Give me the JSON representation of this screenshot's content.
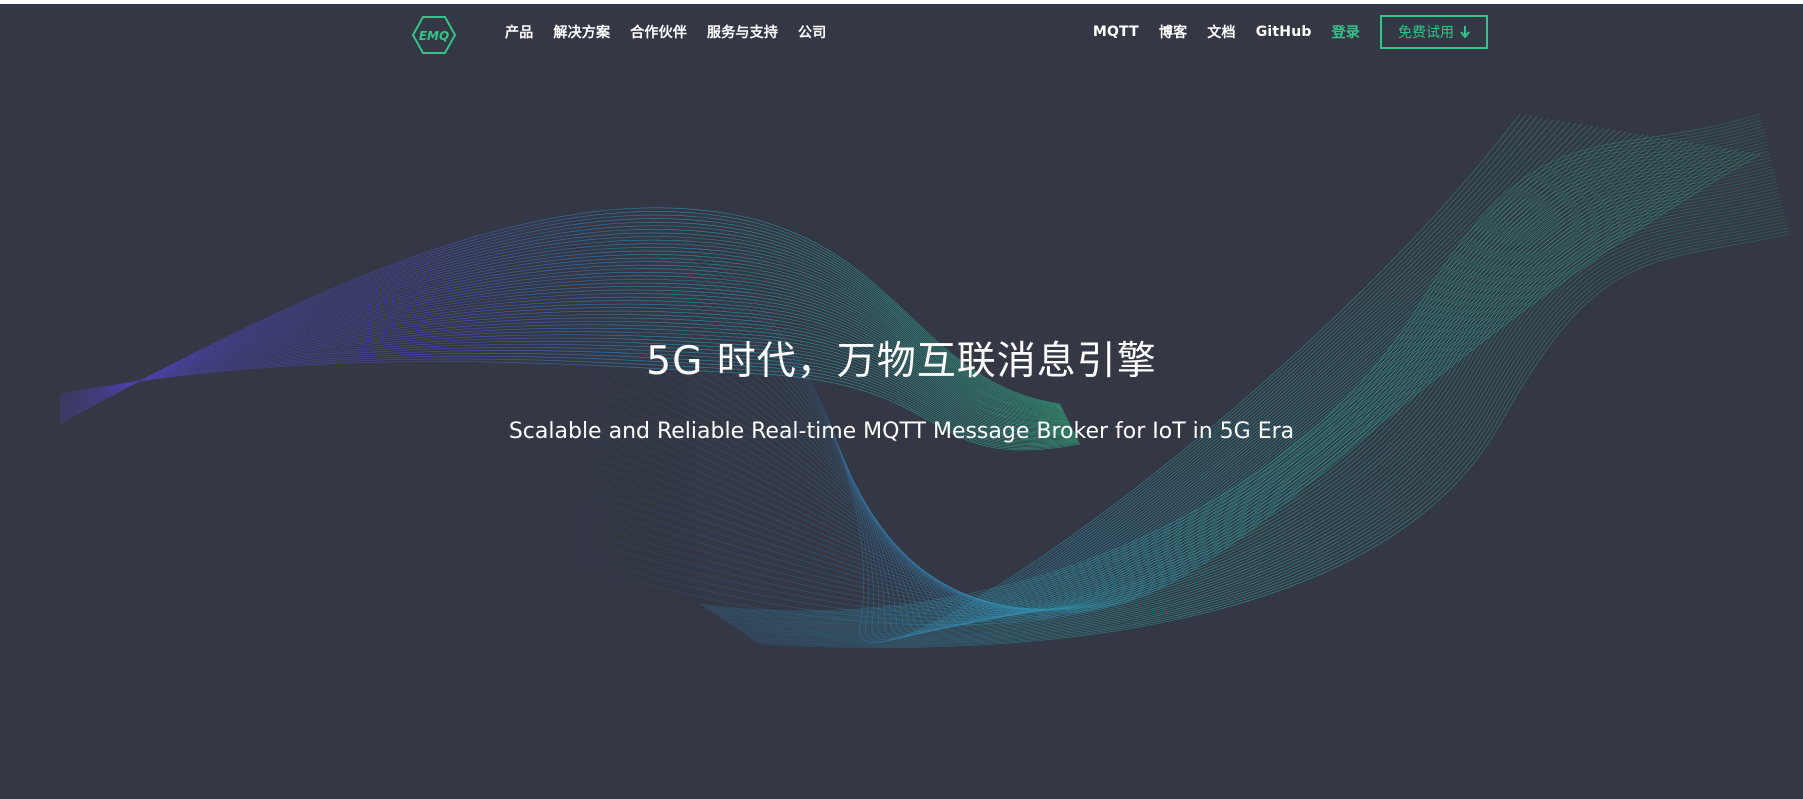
{
  "brand": {
    "logo_text": "EMQ",
    "accent_color": "#34c388",
    "background_color": "#333844"
  },
  "nav": {
    "left_items": [
      {
        "label": "产品"
      },
      {
        "label": "解决方案"
      },
      {
        "label": "合作伙伴"
      },
      {
        "label": "服务与支持"
      },
      {
        "label": "公司"
      }
    ],
    "right_items": [
      {
        "label": "MQTT"
      },
      {
        "label": "博客"
      },
      {
        "label": "文档"
      },
      {
        "label": "GitHub"
      }
    ],
    "login_label": "登录",
    "trial_label": "免费试用",
    "trial_icon": "arrow-down-icon"
  },
  "hero": {
    "title": "5G 时代，万物互联消息引擎",
    "subtitle": "Scalable and Reliable Real-time MQTT Message Broker for IoT in 5G Era",
    "background": "wave-lines-graphic"
  }
}
